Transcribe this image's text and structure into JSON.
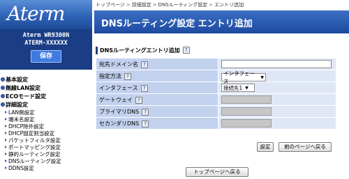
{
  "sidebar": {
    "logo": "Aterm",
    "model_line1": "Aterm WR9300N",
    "model_line2": "ATERM-XXXXXX",
    "save_label": "保存",
    "categories": [
      {
        "label": "基本設定"
      },
      {
        "label": "無線LAN設定"
      },
      {
        "label": "ECOモード設定"
      },
      {
        "label": "詳細設定"
      }
    ],
    "sub_items": [
      "LAN側設定",
      "端末名設定",
      "DHCP除外設定",
      "DHCP固定割当設定",
      "パケットフィルタ設定",
      "ポートマッピング設定",
      "静的ルーティング設定",
      "DNSルーティング設定",
      "DDNS設定"
    ]
  },
  "breadcrumb": [
    "トップページ",
    "詳細設定",
    "DNSルーティング設定",
    "エントリ追加"
  ],
  "breadcrumb_sep": ">",
  "page_title": "DNSルーティング設定 エントリ追加",
  "section_title": "DNSルーティングエントリ追加",
  "help_glyph": "?",
  "form": {
    "domain_label": "宛先ドメイン名",
    "domain_value": "",
    "method_label": "指定方法",
    "method_value": "インタフェース",
    "iface_label": "インタフェース",
    "iface_value": "接続先1",
    "gateway_label": "ゲートウェイ",
    "primary_dns_label": "プライマリDNS",
    "secondary_dns_label": "セカンダリDNS"
  },
  "buttons": {
    "set": "設定",
    "prev": "前のページへ戻る",
    "top": "トップページへ戻る"
  },
  "colors": {
    "title_bar": "#1c4aa0",
    "label_cell": "#c2d1ee",
    "value_cell": "#dfe7f6"
  }
}
